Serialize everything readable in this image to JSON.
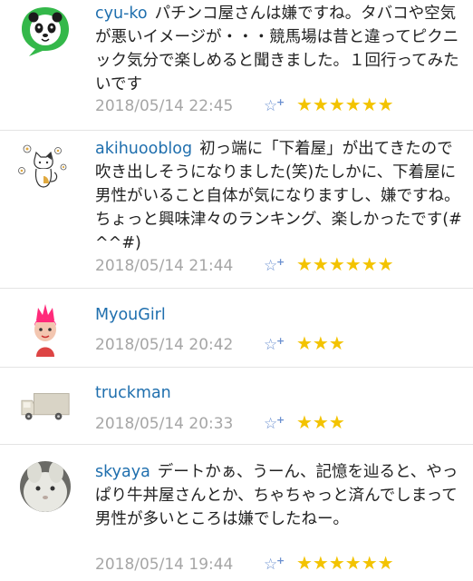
{
  "comments": [
    {
      "username": "cyu-ko",
      "text": "パチンコ屋さんは嫌ですね。タバコや空気が悪いイメージが・・・競馬場は昔と違ってピクニック気分で楽しめると聞きました。１回行ってみたいです",
      "date": "2018/05/14 22:45",
      "like_icon": "star-plus-icon",
      "stars": "★★★★★★",
      "rating": 6,
      "avatar": "panda-speech-bubble"
    },
    {
      "username": "akihuooblog",
      "text": "初っ端に「下着屋」が出てきたので吹き出しそうになりました(笑)たしかに、下着屋に男性がいること自体が気になりますし、嫌ですね。ちょっと興味津々のランキング、楽しかったです(#^^#)",
      "date": "2018/05/14 21:44",
      "like_icon": "star-plus-icon",
      "stars": "★★★★★★",
      "rating": 6,
      "avatar": "cat-and-flowers"
    },
    {
      "username": "MyouGirl",
      "text": "",
      "date": "2018/05/14 20:42",
      "like_icon": "star-plus-icon",
      "stars": "★★★",
      "rating": 3,
      "avatar": "pink-hair-girl"
    },
    {
      "username": "truckman",
      "text": "",
      "date": "2018/05/14 20:33",
      "like_icon": "star-plus-icon",
      "stars": "★★★",
      "rating": 3,
      "avatar": "truck"
    },
    {
      "username": "skyaya",
      "text": "デートかぁ、うーん、記憶を辿ると、やっぱり牛丼屋さんとか、ちゃちゃっと済んでしまって男性が多いところは嫌でしたねー。",
      "date": "2018/05/14 19:44",
      "like_icon": "star-plus-icon",
      "stars": "★★★★★★",
      "rating": 6,
      "avatar": "white-rabbit-photo"
    }
  ],
  "colors": {
    "username": "#1f6fae",
    "date": "#a6a6a6",
    "star": "#f3c300",
    "like": "#6a8fd0",
    "divider": "#e4e4e4"
  }
}
